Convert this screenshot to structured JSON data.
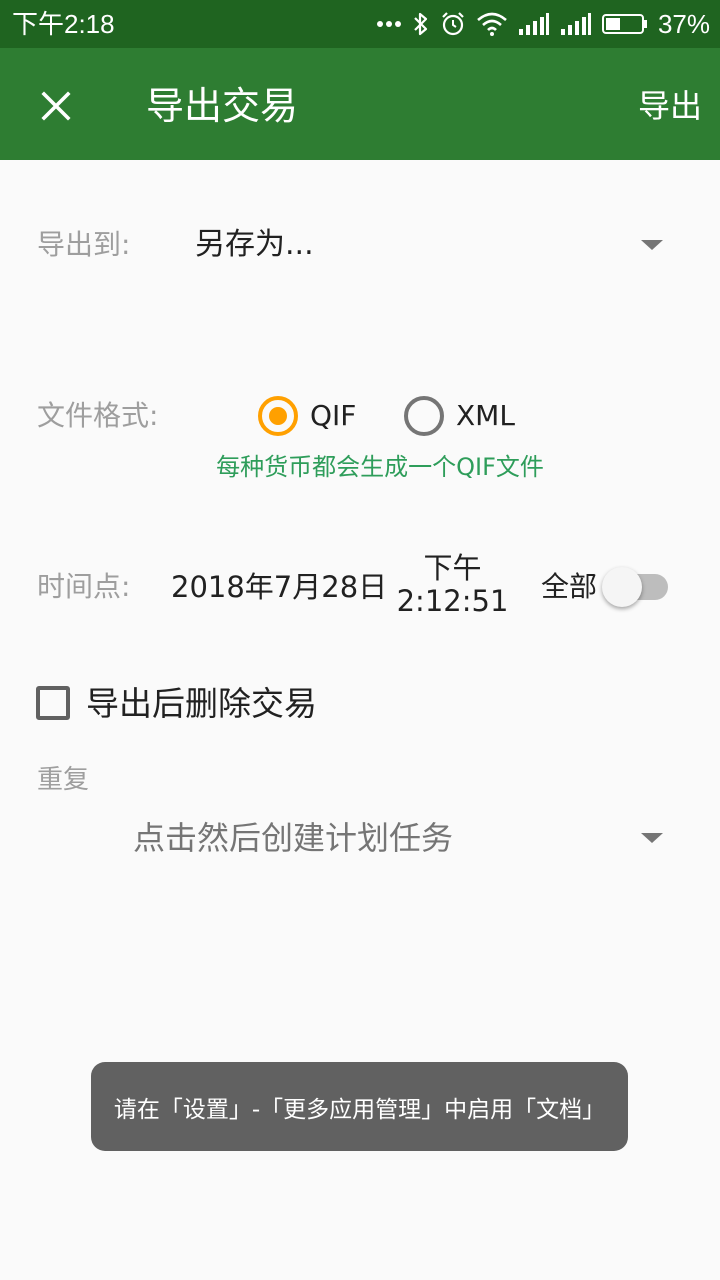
{
  "status_bar": {
    "time": "下午2:18",
    "battery_percent": "37%",
    "icons": [
      "more-dots-icon",
      "bluetooth-icon",
      "alarm-icon",
      "wifi-icon",
      "signal-icon",
      "signal-icon",
      "battery-icon"
    ]
  },
  "app_bar": {
    "title": "导出交易",
    "action_label": "导出",
    "close_icon": "close-icon",
    "background_color": "#2e7d32"
  },
  "export_to": {
    "label": "导出到:",
    "value": "另存为..."
  },
  "file_format": {
    "label": "文件格式:",
    "options": [
      {
        "label": "QIF",
        "selected": true
      },
      {
        "label": "XML",
        "selected": false
      }
    ],
    "hint": "每种货币都会生成一个QIF文件",
    "accent_color": "#ffa000"
  },
  "since": {
    "label": "时间点:",
    "date": "2018年7月28日",
    "time_line1": "下午",
    "time_line2": "2:12:51",
    "all_label": "全部",
    "all_enabled": false
  },
  "delete_after_export": {
    "label": "导出后删除交易",
    "checked": false
  },
  "recurrence": {
    "label": "重复",
    "placeholder": "点击然后创建计划任务"
  },
  "toast": {
    "text": "请在「设置」-「更多应用管理」中启用「文档」"
  }
}
